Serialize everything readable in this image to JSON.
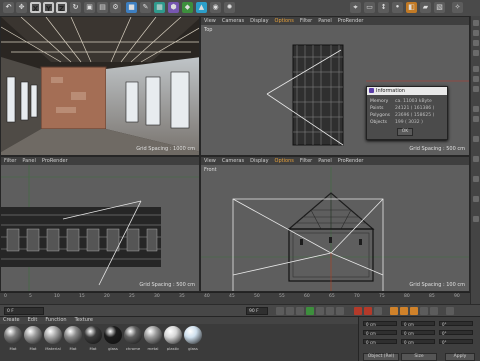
{
  "toolbar": {
    "axis_buttons": [
      "X",
      "Y",
      "Z"
    ]
  },
  "viewports": {
    "top_left": {
      "menu": [
        "View",
        "Cameras",
        "Display",
        "Filter",
        "Panel",
        "ProRender"
      ],
      "grid_spacing": "Grid Spacing : 1000 cm"
    },
    "top_right": {
      "menu": [
        "View",
        "Cameras",
        "Display",
        "Options",
        "Filter",
        "Panel",
        "ProRender"
      ],
      "active_menu": "Options",
      "label": "Top",
      "grid_spacing": "Grid Spacing : 500 cm"
    },
    "bottom_left": {
      "menu": [
        "Filter",
        "Panel",
        "ProRender"
      ],
      "grid_spacing": "Grid Spacing : 500 cm"
    },
    "bottom_right": {
      "menu": [
        "View",
        "Cameras",
        "Display",
        "Options",
        "Filter",
        "Panel",
        "ProRender"
      ],
      "active_menu": "Options",
      "label": "Front",
      "grid_spacing": "Grid Spacing : 100 cm"
    }
  },
  "info_dialog": {
    "title": "Information",
    "rows": [
      {
        "key": "Memory",
        "value": "ca. 11003 kByte"
      },
      {
        "key": "Points",
        "value": "24121 ( 161386 )"
      },
      {
        "key": "Polygons",
        "value": "23696 ( 158625 )"
      },
      {
        "key": "Objects",
        "value": "199 ( 3032 )"
      }
    ],
    "ok_label": "OK"
  },
  "timeline": {
    "ticks": [
      "0",
      "5",
      "10",
      "15",
      "20",
      "25",
      "30",
      "35",
      "40",
      "45",
      "50",
      "55",
      "60",
      "65",
      "70",
      "75",
      "80",
      "85",
      "90"
    ],
    "frame_field": "0 F",
    "end_field": "90 F"
  },
  "material_manager": {
    "menu": [
      "Create",
      "Edit",
      "Function",
      "Texture"
    ],
    "materials": [
      {
        "label": "Mat",
        "color": "#7d7d7d"
      },
      {
        "label": "Mat",
        "color": "#9a9a9a"
      },
      {
        "label": "Material",
        "color": "#a7a7a7"
      },
      {
        "label": "Mat",
        "color": "#8a8a8a"
      },
      {
        "label": "Mat",
        "color": "#3b3b3b"
      },
      {
        "label": "glass",
        "color": "#1c1c1c"
      },
      {
        "label": "chrome",
        "color": "#5f5f5f"
      },
      {
        "label": "metal",
        "color": "#9c9c9c"
      },
      {
        "label": "plastic",
        "color": "#d7d7d7"
      },
      {
        "label": "glass",
        "color": "#cfe0ee"
      }
    ]
  },
  "coordinates": {
    "rows": [
      {
        "a": "X",
        "av": "0 cm",
        "b": "X",
        "bv": "0 cm",
        "c": "H",
        "cv": "0°"
      },
      {
        "a": "Y",
        "av": "0 cm",
        "b": "Y",
        "bv": "0 cm",
        "c": "P",
        "cv": "0°"
      },
      {
        "a": "Z",
        "av": "0 cm",
        "b": "Z",
        "bv": "0 cm",
        "c": "B",
        "cv": "0°"
      }
    ],
    "dropdown1": "Object (Rel)",
    "dropdown2": "Size",
    "apply": "Apply"
  }
}
